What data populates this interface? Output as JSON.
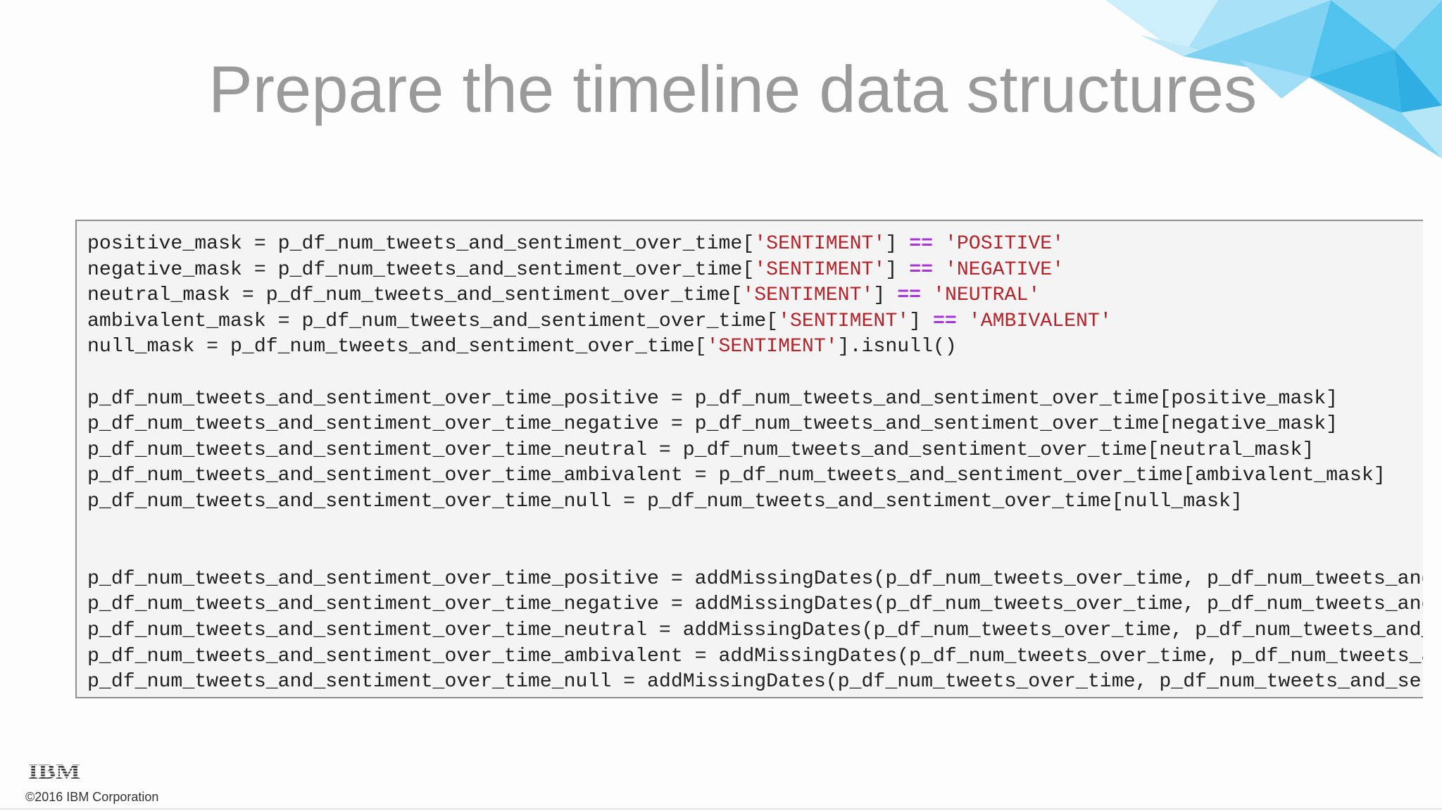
{
  "slide": {
    "title": "Prepare the timeline data structures",
    "copyright": "©2016 IBM Corporation",
    "logo_text": "IBM",
    "colors": {
      "title": "#9a9a9a",
      "code_text": "#1f1f1f",
      "code_string": "#b3242a",
      "code_operator": "#a833d6",
      "code_background": "#f4f4f4",
      "accent_art": "#4fc3ee"
    }
  },
  "code": {
    "lines": [
      [
        {
          "t": "positive_mask = p_df_num_tweets_and_sentiment_over_time["
        },
        {
          "t": "'SENTIMENT'",
          "k": "str"
        },
        {
          "t": "] "
        },
        {
          "t": "==",
          "k": "op"
        },
        {
          "t": " "
        },
        {
          "t": "'POSITIVE'",
          "k": "str"
        }
      ],
      [
        {
          "t": "negative_mask = p_df_num_tweets_and_sentiment_over_time["
        },
        {
          "t": "'SENTIMENT'",
          "k": "str"
        },
        {
          "t": "] "
        },
        {
          "t": "==",
          "k": "op"
        },
        {
          "t": " "
        },
        {
          "t": "'NEGATIVE'",
          "k": "str"
        }
      ],
      [
        {
          "t": "neutral_mask = p_df_num_tweets_and_sentiment_over_time["
        },
        {
          "t": "'SENTIMENT'",
          "k": "str"
        },
        {
          "t": "] "
        },
        {
          "t": "==",
          "k": "op"
        },
        {
          "t": " "
        },
        {
          "t": "'NEUTRAL'",
          "k": "str"
        }
      ],
      [
        {
          "t": "ambivalent_mask = p_df_num_tweets_and_sentiment_over_time["
        },
        {
          "t": "'SENTIMENT'",
          "k": "str"
        },
        {
          "t": "] "
        },
        {
          "t": "==",
          "k": "op"
        },
        {
          "t": " "
        },
        {
          "t": "'AMBIVALENT'",
          "k": "str"
        }
      ],
      [
        {
          "t": "null_mask = p_df_num_tweets_and_sentiment_over_time["
        },
        {
          "t": "'SENTIMENT'",
          "k": "str"
        },
        {
          "t": "].isnull()"
        }
      ],
      [],
      [
        {
          "t": "p_df_num_tweets_and_sentiment_over_time_positive = p_df_num_tweets_and_sentiment_over_time[positive_mask]"
        }
      ],
      [
        {
          "t": "p_df_num_tweets_and_sentiment_over_time_negative = p_df_num_tweets_and_sentiment_over_time[negative_mask]"
        }
      ],
      [
        {
          "t": "p_df_num_tweets_and_sentiment_over_time_neutral = p_df_num_tweets_and_sentiment_over_time[neutral_mask]"
        }
      ],
      [
        {
          "t": "p_df_num_tweets_and_sentiment_over_time_ambivalent = p_df_num_tweets_and_sentiment_over_time[ambivalent_mask]"
        }
      ],
      [
        {
          "t": "p_df_num_tweets_and_sentiment_over_time_null = p_df_num_tweets_and_sentiment_over_time[null_mask]"
        }
      ],
      [],
      [],
      [
        {
          "t": "p_df_num_tweets_and_sentiment_over_time_positive = addMissingDates(p_df_num_tweets_over_time, p_df_num_tweets_and_"
        }
      ],
      [
        {
          "t": "p_df_num_tweets_and_sentiment_over_time_negative = addMissingDates(p_df_num_tweets_over_time, p_df_num_tweets_and_"
        }
      ],
      [
        {
          "t": "p_df_num_tweets_and_sentiment_over_time_neutral = addMissingDates(p_df_num_tweets_over_time, p_df_num_tweets_and_s"
        }
      ],
      [
        {
          "t": "p_df_num_tweets_and_sentiment_over_time_ambivalent = addMissingDates(p_df_num_tweets_over_time, p_df_num_tweets_an"
        }
      ],
      [
        {
          "t": "p_df_num_tweets_and_sentiment_over_time_null = addMissingDates(p_df_num_tweets_over_time, p_df_num_tweets_and_sent"
        }
      ]
    ]
  }
}
